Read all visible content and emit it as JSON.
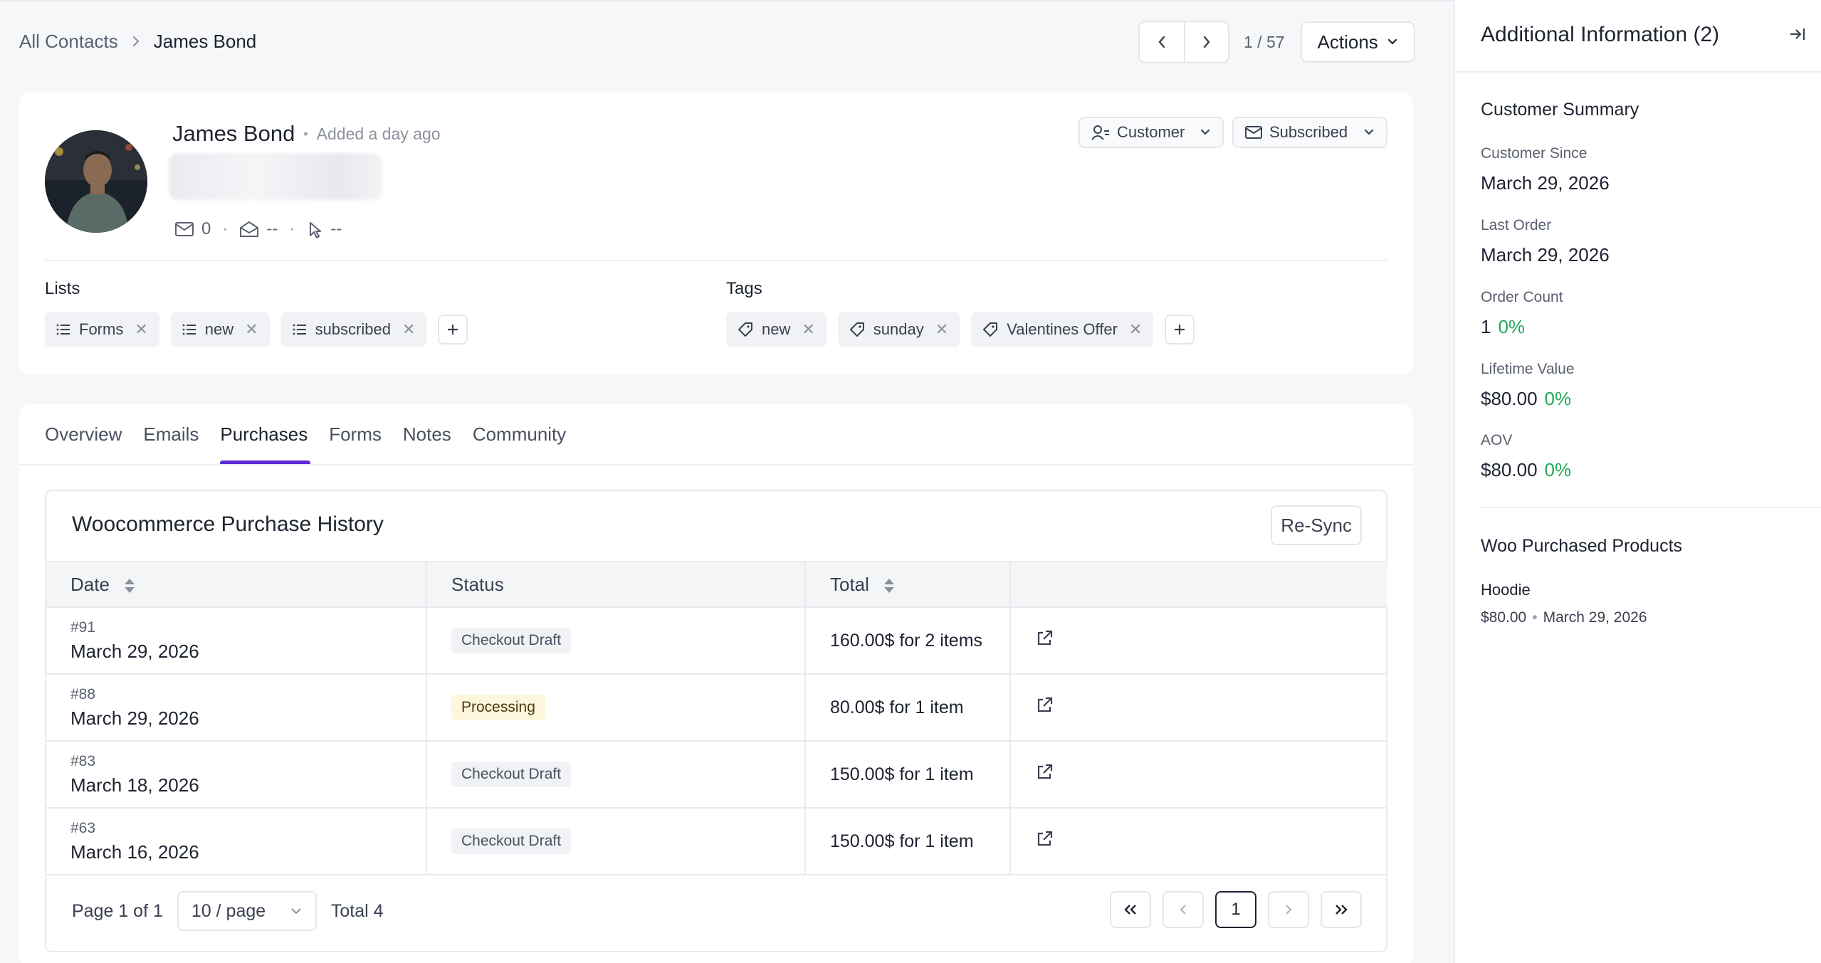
{
  "breadcrumb": {
    "root": "All Contacts",
    "current": "James Bond"
  },
  "pager": {
    "position": "1 / 57",
    "actions_label": "Actions"
  },
  "contact": {
    "name": "James Bond",
    "added": "Added a day ago",
    "emails_sent": "0",
    "opened": "--",
    "clicked": "--",
    "status_dropdown": "Customer",
    "subscription_dropdown": "Subscribed"
  },
  "lists": {
    "label": "Lists",
    "items": [
      "Forms",
      "new",
      "subscribed"
    ]
  },
  "tags": {
    "label": "Tags",
    "items": [
      "new",
      "sunday",
      "Valentines Offer"
    ]
  },
  "tabs": [
    "Overview",
    "Emails",
    "Purchases",
    "Forms",
    "Notes",
    "Community"
  ],
  "active_tab": "Purchases",
  "purchase_history": {
    "title": "Woocommerce Purchase History",
    "resync_label": "Re-Sync",
    "columns": {
      "date": "Date",
      "status": "Status",
      "total": "Total"
    },
    "rows": [
      {
        "order": "#91",
        "date": "March 29, 2026",
        "status": "Checkout Draft",
        "total": "160.00$ for 2 items"
      },
      {
        "order": "#88",
        "date": "March 29, 2026",
        "status": "Processing",
        "total": "80.00$ for 1 item"
      },
      {
        "order": "#83",
        "date": "March 18, 2026",
        "status": "Checkout Draft",
        "total": "150.00$ for 1 item"
      },
      {
        "order": "#63",
        "date": "March 16, 2026",
        "status": "Checkout Draft",
        "total": "150.00$ for 1 item"
      }
    ],
    "footer": {
      "page_info": "Page 1 of 1",
      "per_page": "10 / page",
      "total": "Total 4",
      "current_page": "1"
    }
  },
  "sidebar": {
    "title": "Additional Information (2)",
    "summary_heading": "Customer Summary",
    "customer_since_label": "Customer Since",
    "customer_since": "March 29, 2026",
    "last_order_label": "Last Order",
    "last_order": "March 29, 2026",
    "order_count_label": "Order Count",
    "order_count": "1",
    "order_count_change": "0%",
    "lifetime_value_label": "Lifetime Value",
    "lifetime_value": "$80.00",
    "lifetime_value_change": "0%",
    "aov_label": "AOV",
    "aov": "$80.00",
    "aov_change": "0%",
    "products_heading": "Woo Purchased Products",
    "product_name": "Hoodie",
    "product_price": "$80.00",
    "product_date": "March 29, 2026"
  },
  "colors": {
    "accent": "#5b2bd6",
    "positive": "#1fa85a",
    "processing_bg": "#fdf6dd"
  }
}
